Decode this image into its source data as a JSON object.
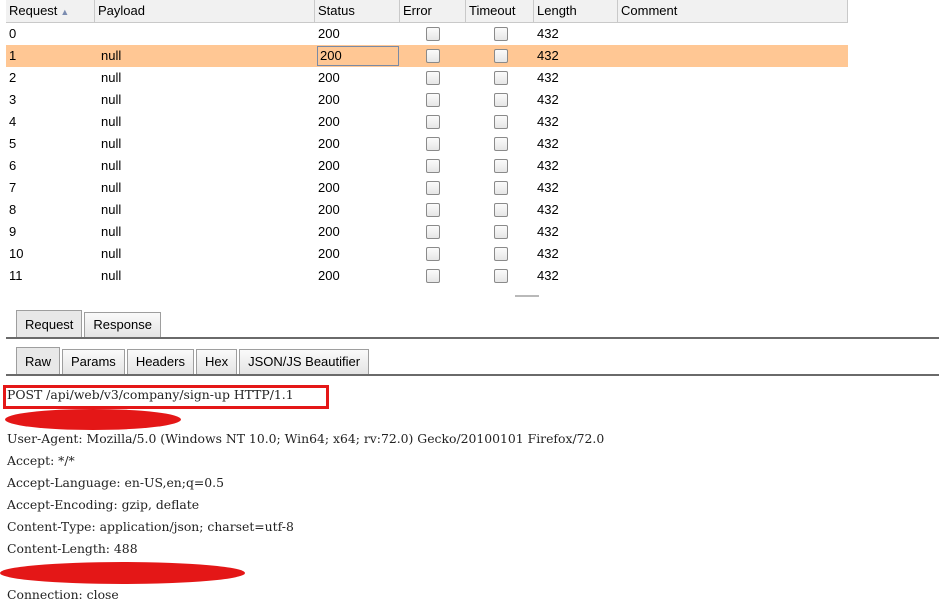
{
  "table": {
    "headers": {
      "request": "Request",
      "payload": "Payload",
      "status": "Status",
      "error": "Error",
      "timeout": "Timeout",
      "length": "Length",
      "comment": "Comment"
    },
    "sort_icon": "sort-ascending-icon",
    "rows": [
      {
        "request": "0",
        "payload": "",
        "status": "200",
        "length": "432"
      },
      {
        "request": "1",
        "payload": "null",
        "status": "200",
        "length": "432"
      },
      {
        "request": "2",
        "payload": "null",
        "status": "200",
        "length": "432"
      },
      {
        "request": "3",
        "payload": "null",
        "status": "200",
        "length": "432"
      },
      {
        "request": "4",
        "payload": "null",
        "status": "200",
        "length": "432"
      },
      {
        "request": "5",
        "payload": "null",
        "status": "200",
        "length": "432"
      },
      {
        "request": "6",
        "payload": "null",
        "status": "200",
        "length": "432"
      },
      {
        "request": "7",
        "payload": "null",
        "status": "200",
        "length": "432"
      },
      {
        "request": "8",
        "payload": "null",
        "status": "200",
        "length": "432"
      },
      {
        "request": "9",
        "payload": "null",
        "status": "200",
        "length": "432"
      },
      {
        "request": "10",
        "payload": "null",
        "status": "200",
        "length": "432"
      },
      {
        "request": "11",
        "payload": "null",
        "status": "200",
        "length": "432"
      }
    ],
    "selected_row_color": "#ffc794"
  },
  "message_tabs": [
    "Request",
    "Response"
  ],
  "view_tabs": [
    "Raw",
    "Params",
    "Headers",
    "Hex",
    "JSON/JS Beautifier"
  ],
  "raw": {
    "request_line_path": "POST /api/web/v3/company/sign-up",
    "request_line_version": " HTTP/1.1",
    "headers": [
      "User-Agent: Mozilla/5.0 (Windows NT 10.0; Win64; x64; rv:72.0) Gecko/20100101 Firefox/72.0",
      "Accept: */*",
      "Accept-Language: en-US,en;q=0.5",
      "Accept-Encoding: gzip, deflate",
      "Content-Type: application/json; charset=utf-8",
      "Content-Length: 488"
    ],
    "after_redaction": "Connection: close",
    "annotation_color": "#e41717"
  }
}
